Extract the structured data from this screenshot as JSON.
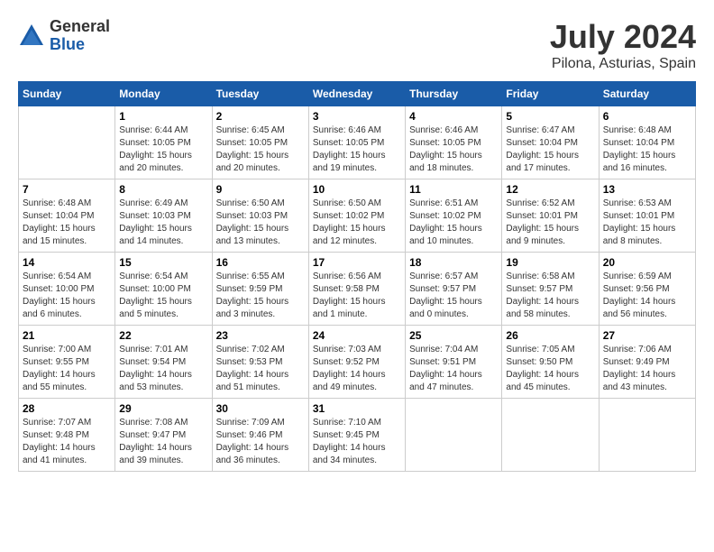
{
  "header": {
    "logo_general": "General",
    "logo_blue": "Blue",
    "month_title": "July 2024",
    "location": "Pilona, Asturias, Spain"
  },
  "days_of_week": [
    "Sunday",
    "Monday",
    "Tuesday",
    "Wednesday",
    "Thursday",
    "Friday",
    "Saturday"
  ],
  "weeks": [
    [
      {
        "day": "",
        "info": ""
      },
      {
        "day": "1",
        "info": "Sunrise: 6:44 AM\nSunset: 10:05 PM\nDaylight: 15 hours\nand 20 minutes."
      },
      {
        "day": "2",
        "info": "Sunrise: 6:45 AM\nSunset: 10:05 PM\nDaylight: 15 hours\nand 20 minutes."
      },
      {
        "day": "3",
        "info": "Sunrise: 6:46 AM\nSunset: 10:05 PM\nDaylight: 15 hours\nand 19 minutes."
      },
      {
        "day": "4",
        "info": "Sunrise: 6:46 AM\nSunset: 10:05 PM\nDaylight: 15 hours\nand 18 minutes."
      },
      {
        "day": "5",
        "info": "Sunrise: 6:47 AM\nSunset: 10:04 PM\nDaylight: 15 hours\nand 17 minutes."
      },
      {
        "day": "6",
        "info": "Sunrise: 6:48 AM\nSunset: 10:04 PM\nDaylight: 15 hours\nand 16 minutes."
      }
    ],
    [
      {
        "day": "7",
        "info": "Sunrise: 6:48 AM\nSunset: 10:04 PM\nDaylight: 15 hours\nand 15 minutes."
      },
      {
        "day": "8",
        "info": "Sunrise: 6:49 AM\nSunset: 10:03 PM\nDaylight: 15 hours\nand 14 minutes."
      },
      {
        "day": "9",
        "info": "Sunrise: 6:50 AM\nSunset: 10:03 PM\nDaylight: 15 hours\nand 13 minutes."
      },
      {
        "day": "10",
        "info": "Sunrise: 6:50 AM\nSunset: 10:02 PM\nDaylight: 15 hours\nand 12 minutes."
      },
      {
        "day": "11",
        "info": "Sunrise: 6:51 AM\nSunset: 10:02 PM\nDaylight: 15 hours\nand 10 minutes."
      },
      {
        "day": "12",
        "info": "Sunrise: 6:52 AM\nSunset: 10:01 PM\nDaylight: 15 hours\nand 9 minutes."
      },
      {
        "day": "13",
        "info": "Sunrise: 6:53 AM\nSunset: 10:01 PM\nDaylight: 15 hours\nand 8 minutes."
      }
    ],
    [
      {
        "day": "14",
        "info": "Sunrise: 6:54 AM\nSunset: 10:00 PM\nDaylight: 15 hours\nand 6 minutes."
      },
      {
        "day": "15",
        "info": "Sunrise: 6:54 AM\nSunset: 10:00 PM\nDaylight: 15 hours\nand 5 minutes."
      },
      {
        "day": "16",
        "info": "Sunrise: 6:55 AM\nSunset: 9:59 PM\nDaylight: 15 hours\nand 3 minutes."
      },
      {
        "day": "17",
        "info": "Sunrise: 6:56 AM\nSunset: 9:58 PM\nDaylight: 15 hours\nand 1 minute."
      },
      {
        "day": "18",
        "info": "Sunrise: 6:57 AM\nSunset: 9:57 PM\nDaylight: 15 hours\nand 0 minutes."
      },
      {
        "day": "19",
        "info": "Sunrise: 6:58 AM\nSunset: 9:57 PM\nDaylight: 14 hours\nand 58 minutes."
      },
      {
        "day": "20",
        "info": "Sunrise: 6:59 AM\nSunset: 9:56 PM\nDaylight: 14 hours\nand 56 minutes."
      }
    ],
    [
      {
        "day": "21",
        "info": "Sunrise: 7:00 AM\nSunset: 9:55 PM\nDaylight: 14 hours\nand 55 minutes."
      },
      {
        "day": "22",
        "info": "Sunrise: 7:01 AM\nSunset: 9:54 PM\nDaylight: 14 hours\nand 53 minutes."
      },
      {
        "day": "23",
        "info": "Sunrise: 7:02 AM\nSunset: 9:53 PM\nDaylight: 14 hours\nand 51 minutes."
      },
      {
        "day": "24",
        "info": "Sunrise: 7:03 AM\nSunset: 9:52 PM\nDaylight: 14 hours\nand 49 minutes."
      },
      {
        "day": "25",
        "info": "Sunrise: 7:04 AM\nSunset: 9:51 PM\nDaylight: 14 hours\nand 47 minutes."
      },
      {
        "day": "26",
        "info": "Sunrise: 7:05 AM\nSunset: 9:50 PM\nDaylight: 14 hours\nand 45 minutes."
      },
      {
        "day": "27",
        "info": "Sunrise: 7:06 AM\nSunset: 9:49 PM\nDaylight: 14 hours\nand 43 minutes."
      }
    ],
    [
      {
        "day": "28",
        "info": "Sunrise: 7:07 AM\nSunset: 9:48 PM\nDaylight: 14 hours\nand 41 minutes."
      },
      {
        "day": "29",
        "info": "Sunrise: 7:08 AM\nSunset: 9:47 PM\nDaylight: 14 hours\nand 39 minutes."
      },
      {
        "day": "30",
        "info": "Sunrise: 7:09 AM\nSunset: 9:46 PM\nDaylight: 14 hours\nand 36 minutes."
      },
      {
        "day": "31",
        "info": "Sunrise: 7:10 AM\nSunset: 9:45 PM\nDaylight: 14 hours\nand 34 minutes."
      },
      {
        "day": "",
        "info": ""
      },
      {
        "day": "",
        "info": ""
      },
      {
        "day": "",
        "info": ""
      }
    ]
  ]
}
